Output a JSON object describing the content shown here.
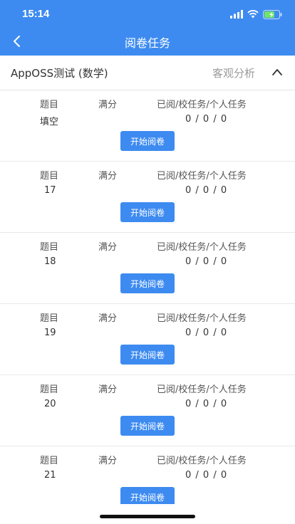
{
  "status": {
    "time": "15:14"
  },
  "header": {
    "title": "阅卷任务"
  },
  "subject": {
    "name": "AppOSS测试 (数学)",
    "analysis_label": "客观分析"
  },
  "columns": {
    "question": "题目",
    "full_score": "满分",
    "tasks": "已阅/校任务/个人任务"
  },
  "button_label": "开始阅卷",
  "items": [
    {
      "question": "填空",
      "full_score": "",
      "tasks": "0 / 0 / 0"
    },
    {
      "question": "17",
      "full_score": "",
      "tasks": "0 / 0 / 0"
    },
    {
      "question": "18",
      "full_score": "",
      "tasks": "0 / 0 / 0"
    },
    {
      "question": "19",
      "full_score": "",
      "tasks": "0 / 0 / 0"
    },
    {
      "question": "20",
      "full_score": "",
      "tasks": "0 / 0 / 0"
    },
    {
      "question": "21",
      "full_score": "",
      "tasks": "0 / 0 / 0"
    }
  ],
  "colors": {
    "primary": "#3d8bf0"
  },
  "icons": {
    "back": "chevron-left-icon",
    "collapse": "chevron-up-icon",
    "signal": "signal-icon",
    "wifi": "wifi-icon",
    "battery": "battery-charging-icon"
  }
}
